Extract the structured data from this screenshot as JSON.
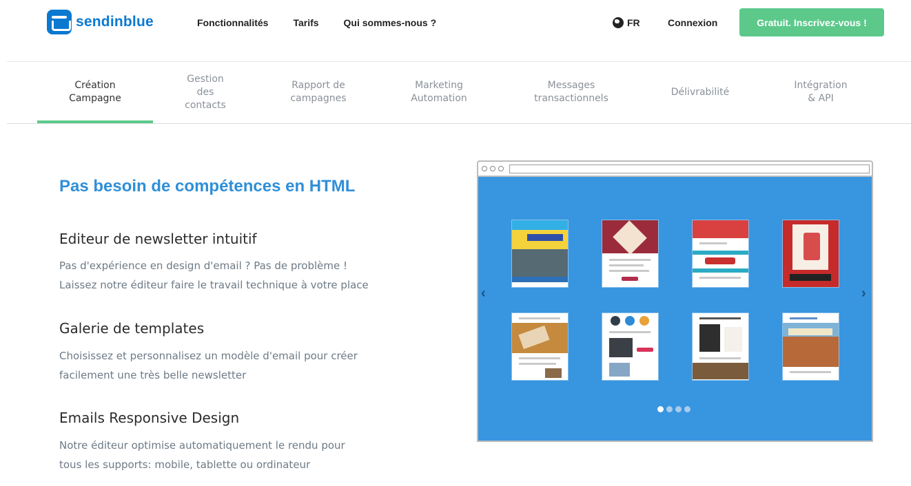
{
  "brand": {
    "name": "sendinblue"
  },
  "nav": {
    "links": [
      "Fonctionnalités",
      "Tarifs",
      "Qui sommes-nous ?"
    ],
    "language": "FR",
    "login": "Connexion",
    "signup": "Gratuit. Inscrivez-vous !"
  },
  "tabs": [
    {
      "label": "Création\nCampagne",
      "active": true
    },
    {
      "label": "Gestion\ndes\ncontacts",
      "active": false
    },
    {
      "label": "Rapport de\ncampagnes",
      "active": false
    },
    {
      "label": "Marketing\nAutomation",
      "active": false
    },
    {
      "label": "Messages\ntransactionnels",
      "active": false
    },
    {
      "label": "Délivrabilité",
      "active": false
    },
    {
      "label": "Intégration\n& API",
      "active": false
    }
  ],
  "main": {
    "headline": "Pas besoin de compétences en HTML",
    "features": [
      {
        "title": "Editeur de newsletter intuitif",
        "lines": [
          "Pas d'expérience en design d'email ? Pas de problème !",
          "Laissez notre éditeur faire le travail technique à votre place"
        ]
      },
      {
        "title": "Galerie de templates",
        "lines": [
          "Choisissez et personnalisez un modèle d'email pour créer",
          "facilement une très belle newsletter"
        ]
      },
      {
        "title": "Emails Responsive Design",
        "lines": [
          "Notre éditeur optimise automatiquement le rendu pour",
          "tous les supports: mobile, tablette ou ordinateur"
        ]
      }
    ]
  },
  "carousel": {
    "pages": 4,
    "current_page": 1,
    "prev_icon": "chevron-left-icon",
    "next_icon": "chevron-right-icon"
  },
  "colors": {
    "brand_blue": "#0b79d0",
    "accent_green": "#5cc98b",
    "headline_blue": "#2f8fd8",
    "mockup_blue": "#3895e0"
  }
}
